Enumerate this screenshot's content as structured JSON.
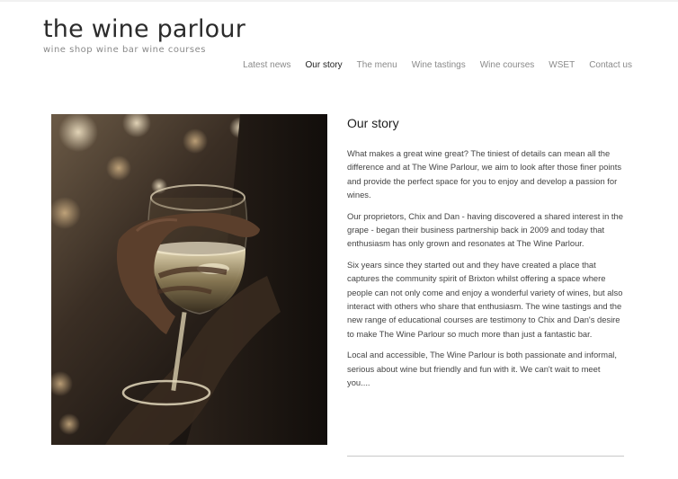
{
  "site": {
    "title": "the wine parlour",
    "tagline": "wine shop  wine bar  wine courses"
  },
  "nav": {
    "items": [
      {
        "label": "Latest news"
      },
      {
        "label": "Our story"
      },
      {
        "label": "The menu"
      },
      {
        "label": "Wine tastings"
      },
      {
        "label": "Wine courses"
      },
      {
        "label": "WSET"
      },
      {
        "label": "Contact us"
      }
    ],
    "active_index": 1
  },
  "article": {
    "heading": "Our story",
    "paragraphs": [
      "What makes a great wine great? The tiniest of details can mean all the difference and at The Wine Parlour, we aim to look after those finer points and provide the perfect space for you to enjoy and develop a passion for wines.",
      "Our proprietors, Chix and Dan - having discovered a shared interest in the grape - began their business partnership back in 2009 and today that enthusiasm has only grown and resonates at The Wine Parlour.",
      "Six years since they started out and they have created a place that captures the community spirit of Brixton whilst offering a space where people can not only come and enjoy a wonderful variety of wines, but also interact with others who share that enthusiasm. The wine tastings and the new range of educational courses are testimony to Chix and Dan's desire to make The Wine Parlour so much more than just a fantastic bar.",
      "Local and accessible, The Wine Parlour is both passionate and informal, serious about wine but friendly and fun with it. We can't wait to meet you...."
    ]
  },
  "colors": {
    "nav_text": "#8a8a8a",
    "nav_active": "#1e1e1e",
    "logo_text": "#2b2b2b"
  }
}
